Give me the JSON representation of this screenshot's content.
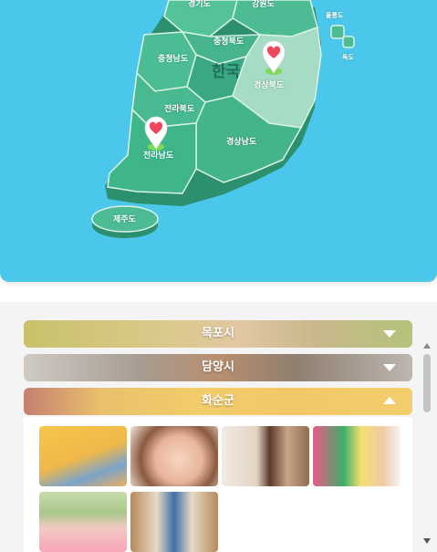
{
  "map": {
    "country_label": "한국",
    "regions": [
      {
        "id": "gyeonggi",
        "label": "경기도"
      },
      {
        "id": "gangwon",
        "label": "강원도"
      },
      {
        "id": "chungbuk",
        "label": "충청북도"
      },
      {
        "id": "chungnam",
        "label": "충청남도"
      },
      {
        "id": "gyeongbuk",
        "label": "경상북도"
      },
      {
        "id": "jeonbuk",
        "label": "전라북도"
      },
      {
        "id": "jeonnam",
        "label": "전라남도"
      },
      {
        "id": "gyeongnam",
        "label": "경상남도"
      },
      {
        "id": "jeju",
        "label": "제주도"
      },
      {
        "id": "ulleung",
        "label": "울릉도"
      },
      {
        "id": "dokdo",
        "label": "독도"
      }
    ],
    "pins": [
      {
        "region": "gyeongbuk",
        "icon": "heart-location-pin-icon"
      },
      {
        "region": "jeonnam",
        "icon": "heart-location-pin-icon"
      }
    ],
    "colors": {
      "sea": "#4ac7ea",
      "land": "#3fb891",
      "land_light": "#9fd9bf",
      "pin_heart": "#f0475e"
    }
  },
  "accordion": [
    {
      "label": "목포시",
      "expanded": false,
      "icon": "chevron-down-icon"
    },
    {
      "label": "담양시",
      "expanded": false,
      "icon": "chevron-down-icon"
    },
    {
      "label": "화순군",
      "expanded": true,
      "icon": "chevron-up-icon"
    }
  ],
  "photos": [
    {
      "name": "photo-baby-reading"
    },
    {
      "name": "photo-girl-crying"
    },
    {
      "name": "photo-girl-studying"
    },
    {
      "name": "photo-boy-sleeping"
    },
    {
      "name": "photo-girl-outdoors"
    },
    {
      "name": "photo-boy-doorway"
    }
  ]
}
